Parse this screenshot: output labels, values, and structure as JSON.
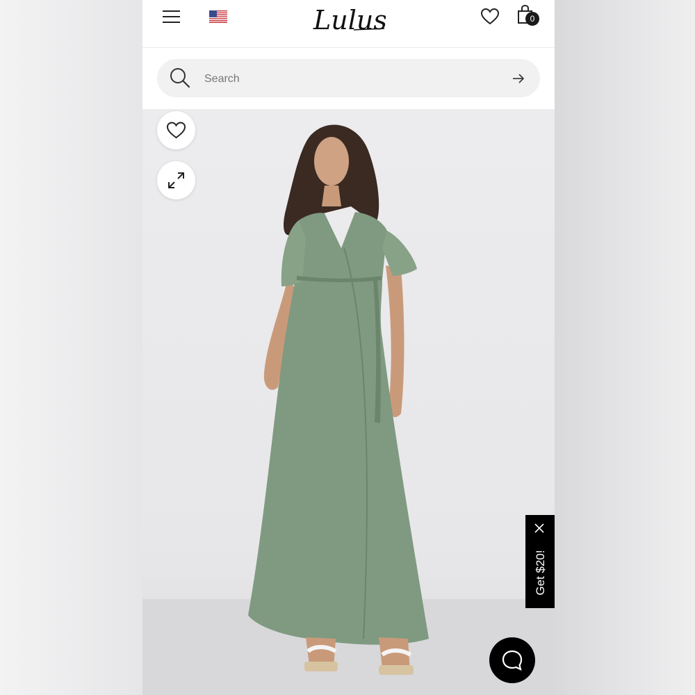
{
  "header": {
    "logo_text": "Lulus",
    "menu_icon": "hamburger-menu-icon",
    "flag_icon": "us-flag-icon",
    "wishlist_icon": "heart-icon",
    "cart_icon": "shopping-bag-icon",
    "cart_count": "0"
  },
  "search": {
    "placeholder": "Search",
    "search_icon": "search-icon",
    "submit_icon": "arrow-right-icon"
  },
  "product_image": {
    "alt": "Sage green short sleeve wrap maxi dress",
    "wishlist_icon": "heart-icon",
    "expand_icon": "expand-icon",
    "dress_color": "#7f9a80"
  },
  "promo": {
    "label": "Get $20!",
    "close_icon": "close-icon"
  },
  "chat": {
    "icon": "chat-bubble-icon"
  },
  "colors": {
    "background": "#ffffff",
    "search_bg": "#f1f1f2",
    "accent": "#000000"
  }
}
